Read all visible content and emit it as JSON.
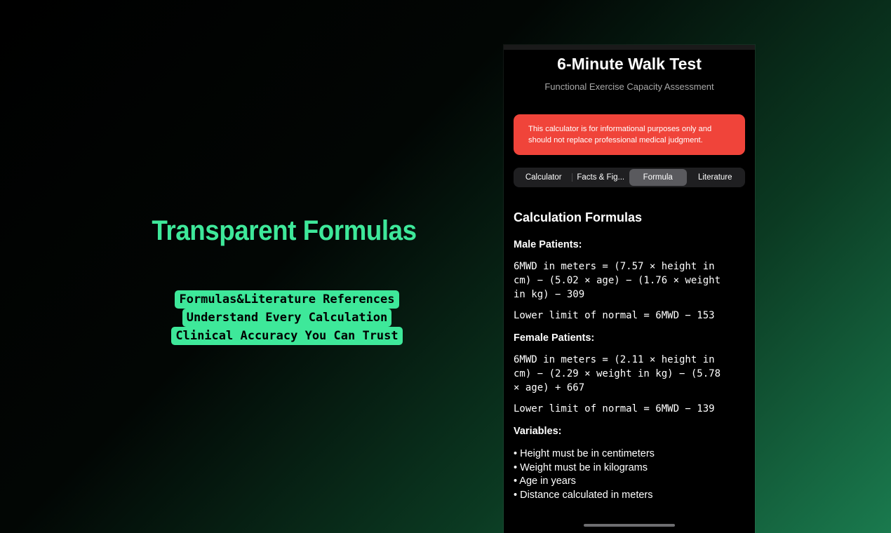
{
  "promo": {
    "title": "Transparent Formulas",
    "lines": [
      "Formulas&Literature References",
      "Understand Every Calculation",
      "Clinical Accuracy You Can Trust"
    ]
  },
  "app": {
    "title": "6-Minute Walk Test",
    "subtitle": "Functional Exercise Capacity Assessment",
    "disclaimer": {
      "line1": "This calculator is for informational purposes only and",
      "line2": "should not replace professional medical judgment."
    },
    "tabs": [
      {
        "label": "Calculator",
        "selected": false
      },
      {
        "label": "Facts & Fig...",
        "selected": false
      },
      {
        "label": "Formula",
        "selected": true
      },
      {
        "label": "Literature",
        "selected": false
      }
    ],
    "formulas": {
      "heading": "Calculation Formulas",
      "male_heading": "Male Patients:",
      "male_formula": "6MWD in meters = (7.57 × height in\ncm) − (5.02 × age) − (1.76 × weight\nin kg) − 309",
      "male_lln": "Lower limit of normal = 6MWD − 153",
      "female_heading": "Female Patients:",
      "female_formula": "6MWD in meters = (2.11 × height in\ncm) − (2.29 × weight in kg) − (5.78\n× age) + 667",
      "female_lln": "Lower limit of normal = 6MWD − 139",
      "variables_heading": "Variables:",
      "variables": [
        "• Height must be in centimeters",
        "• Weight must be in kilograms",
        "• Age in years",
        "• Distance calculated in meters"
      ]
    }
  },
  "colors": {
    "accent": "#3ee89a",
    "alert": "#f0443a",
    "background": "#000000"
  }
}
